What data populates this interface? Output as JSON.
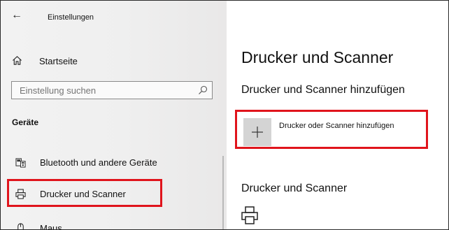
{
  "window": {
    "title": "Einstellungen"
  },
  "sidebar": {
    "home_label": "Startseite",
    "search_placeholder": "Einstellung suchen",
    "section_title": "Geräte",
    "items": [
      {
        "label": "Bluetooth und andere Geräte",
        "icon": "bluetooth-devices-icon"
      },
      {
        "label": "Drucker und Scanner",
        "icon": "printer-icon",
        "selected": true
      },
      {
        "label": "Maus",
        "icon": "mouse-icon"
      }
    ]
  },
  "main": {
    "page_title": "Drucker und Scanner",
    "add_section_title": "Drucker und Scanner hinzufügen",
    "add_button_label": "Drucker oder Scanner hinzufügen",
    "list_section_title": "Drucker und Scanner"
  },
  "colors": {
    "highlight": "#e0141c",
    "add_button_bg": "#d4d4d4"
  }
}
